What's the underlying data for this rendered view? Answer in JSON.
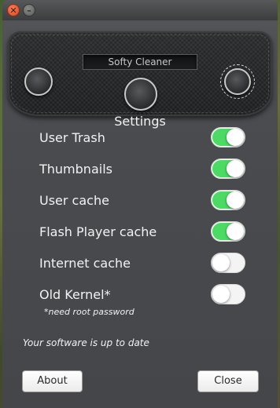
{
  "window": {
    "close_glyph": "✕",
    "minimize_glyph": "–"
  },
  "header": {
    "app_title": "Softy Cleaner",
    "section_label": "Settings"
  },
  "options": [
    {
      "label": "User Trash",
      "enabled": true
    },
    {
      "label": "Thumbnails",
      "enabled": true
    },
    {
      "label": "User cache",
      "enabled": true
    },
    {
      "label": "Flash Player cache",
      "enabled": true
    },
    {
      "label": "Internet cache",
      "enabled": false
    },
    {
      "label": "Old Kernel*",
      "enabled": false
    }
  ],
  "root_note": "*need root password",
  "status_message": "Your software is up to date",
  "buttons": {
    "about": "About",
    "close": "Close"
  },
  "colors": {
    "toggle_on": "#4cd964",
    "toggle_off": "#f4f4f4",
    "close_button": "#e5562a"
  }
}
